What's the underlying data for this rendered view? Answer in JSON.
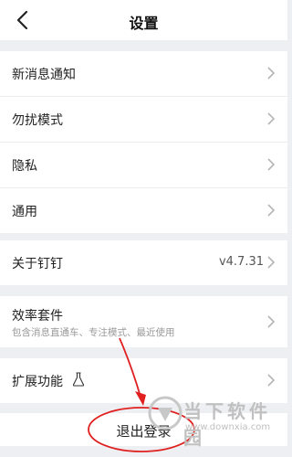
{
  "header": {
    "title": "设置",
    "back_icon": "chevron-left-icon"
  },
  "group1": [
    {
      "label": "新消息通知"
    },
    {
      "label": "勿扰模式"
    },
    {
      "label": "隐私"
    },
    {
      "label": "通用"
    }
  ],
  "about": {
    "label": "关于钉钉",
    "version": "v4.7.31"
  },
  "efficiency": {
    "label": "效率套件",
    "subtitle": "包含消息直通车、专注模式、最近使用"
  },
  "extensions": {
    "label": "扩展功能",
    "icon": "beaker-icon"
  },
  "logout": {
    "label": "退出登录"
  },
  "annotation": {
    "color": "#e02020"
  },
  "watermark": {
    "name": "当下软件园",
    "url": "www.downxia.com"
  }
}
